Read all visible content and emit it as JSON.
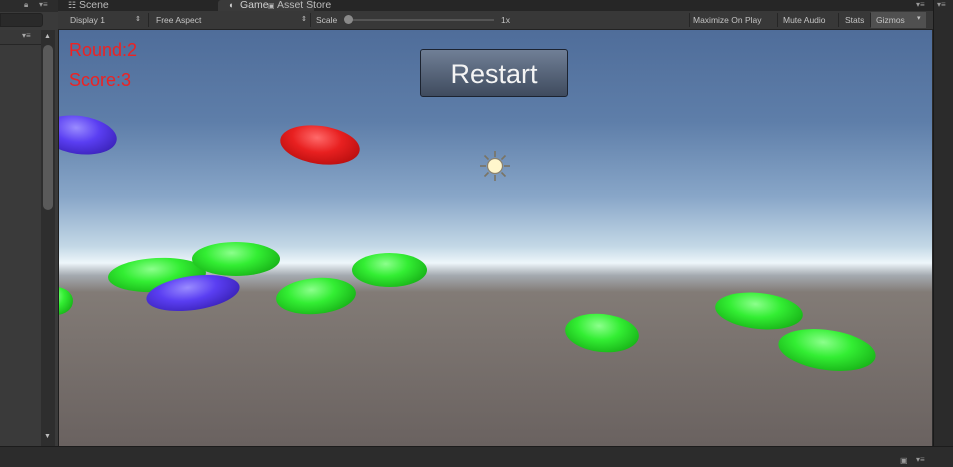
{
  "tabs": [
    {
      "label": "Scene",
      "icon": "grid-icon"
    },
    {
      "label": "Game",
      "icon": "pacman-icon"
    },
    {
      "label": "Asset Store",
      "icon": "lock-icon"
    }
  ],
  "toolbar": {
    "display": "Display 1",
    "aspect": "Free Aspect",
    "scale_label": "Scale",
    "scale_value": "1x",
    "maximize": "Maximize On Play",
    "mute": "Mute Audio",
    "stats": "Stats",
    "gizmos": "Gizmos"
  },
  "hud": {
    "round": "Round:2",
    "score": "Score:3",
    "restart": "Restart"
  },
  "scene_objects": [
    {
      "color": "blue"
    },
    {
      "color": "red"
    },
    {
      "color": "green"
    },
    {
      "color": "green"
    },
    {
      "color": "green"
    },
    {
      "color": "blue"
    },
    {
      "color": "green"
    },
    {
      "color": "green"
    },
    {
      "color": "green"
    },
    {
      "color": "green"
    },
    {
      "color": "green"
    },
    {
      "color": "green"
    }
  ],
  "colors": {
    "hud_text": "#ee2222",
    "disk_green": "#33ee33",
    "disk_blue": "#5a3ef2",
    "disk_red": "#e82020"
  }
}
